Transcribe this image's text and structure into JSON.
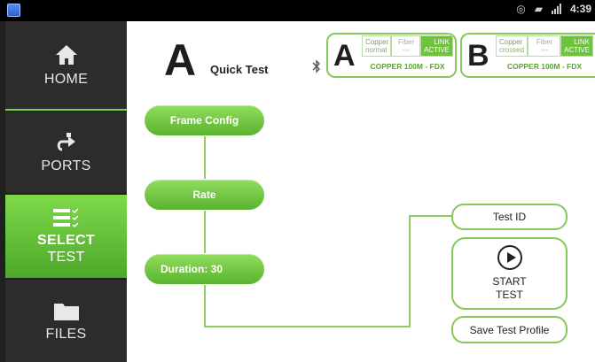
{
  "status_bar": {
    "time": "4:39"
  },
  "sidebar": {
    "items": [
      {
        "label": "HOME",
        "icon": "home-icon"
      },
      {
        "label": "PORTS",
        "icon": "ports-icon"
      },
      {
        "label_line1": "SELECT",
        "label_line2": "TEST",
        "icon": "select-test-icon",
        "selected": true
      },
      {
        "label": "FILES",
        "icon": "folder-icon"
      }
    ]
  },
  "header": {
    "port_letter": "A",
    "title": "Quick Test"
  },
  "ports": {
    "a": {
      "letter": "A",
      "copper_title": "Copper",
      "copper_sub": "normal",
      "fiber_title": "Fiber",
      "fiber_sub": "---",
      "link_title": "LINK",
      "link_sub": "ACTIVE",
      "status": "COPPER 100M  - FDX"
    },
    "b": {
      "letter": "B",
      "copper_title": "Copper",
      "copper_sub": "crossed",
      "fiber_title": "Fiber",
      "fiber_sub": "---",
      "link_title": "LINK",
      "link_sub": "ACTIVE",
      "status": "COPPER 100M  - FDX"
    }
  },
  "flow": {
    "frame_config": "Frame Config",
    "rate": "Rate",
    "duration": "Duration:  30"
  },
  "actions": {
    "test_id": "Test ID",
    "start_line1": "START",
    "start_line2": "TEST",
    "save_profile": "Save Test Profile"
  },
  "colors": {
    "accent": "#6fc23e",
    "sidebar_bg": "#2c2c2c",
    "status_text": "#5aa52e"
  }
}
